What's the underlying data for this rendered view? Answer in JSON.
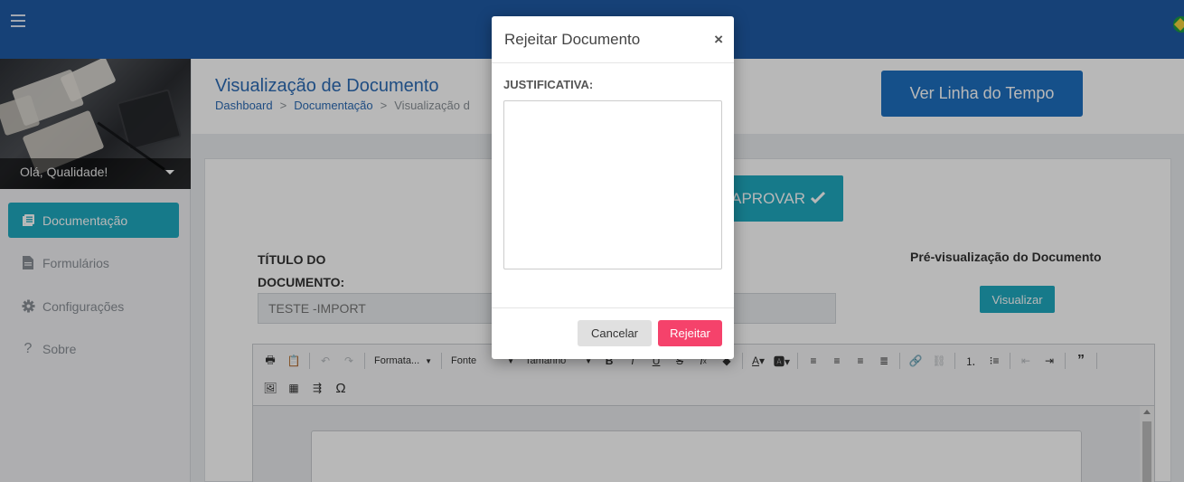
{
  "topbar": {
    "menu_icon": "hamburger-icon",
    "flag_icon": "brazil-flag-icon",
    "color": "#1f5aa6"
  },
  "sidebar": {
    "user_greeting": "Olá, Qualidade!",
    "items": [
      {
        "label": "Documentação",
        "icon": "document-list-icon",
        "active": true
      },
      {
        "label": "Formulários",
        "icon": "file-icon",
        "active": false
      },
      {
        "label": "Configurações",
        "icon": "gear-icon",
        "active": false
      },
      {
        "label": "Sobre",
        "icon": "question-icon",
        "active": false
      }
    ]
  },
  "header": {
    "title": "Visualização de Documento",
    "breadcrumb": [
      "Dashboard",
      "Documentação",
      "Visualização d"
    ],
    "timeline_button": "Ver Linha do Tempo"
  },
  "content": {
    "approve_button": "APROVAR",
    "title_label_line1": "TÍTULO DO",
    "title_label_line2": "DOCUMENTO:",
    "title_value": "TESTE -IMPORT",
    "preview_label": "Pré-visualização do Documento",
    "preview_button": "Visualizar",
    "editor": {
      "format_combo": "Formata...",
      "font_combo": "Fonte",
      "size_combo": "Tamanho"
    }
  },
  "modal": {
    "title": "Rejeitar Documento",
    "close": "×",
    "field_label": "JUSTIFICATIVA:",
    "justification_value": "",
    "cancel_button": "Cancelar",
    "reject_button": "Rejeitar"
  },
  "colors": {
    "primary": "#1e6fbf",
    "teal": "#1fa9bf",
    "danger": "#f5426b"
  }
}
